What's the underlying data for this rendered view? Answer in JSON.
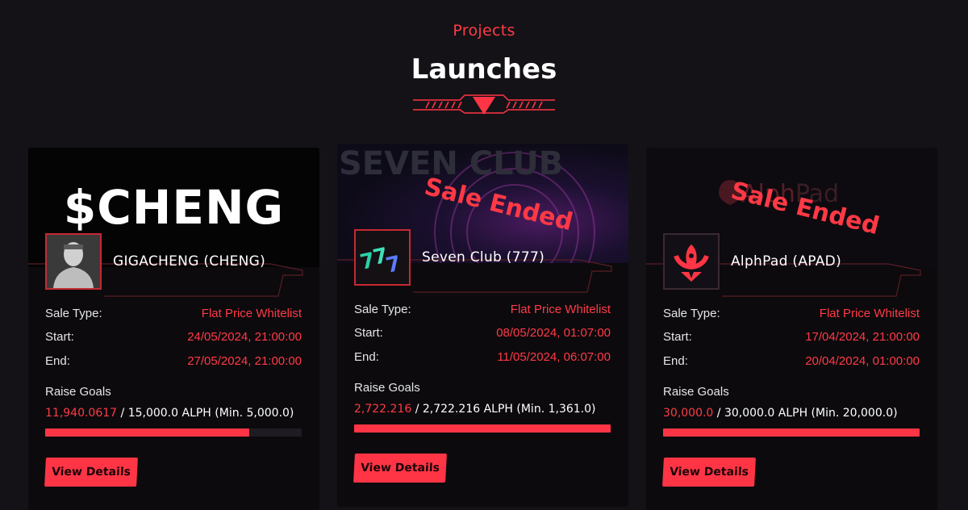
{
  "header": {
    "eyebrow": "Projects",
    "title": "Launches"
  },
  "colors": {
    "accent": "#ff3545",
    "background": "#141216",
    "card": "#0c0a0d"
  },
  "labels": {
    "sale_type": "Sale Type:",
    "start": "Start:",
    "end": "End:",
    "raise_goals": "Raise Goals",
    "view_details": "View Details"
  },
  "projects": [
    {
      "banner_text": "$CHENG",
      "name": "GIGACHENG (CHENG)",
      "sale_type": "Flat Price Whitelist",
      "start": "24/05/2024, 21:00:00",
      "end": "27/05/2024, 21:00:00",
      "raised": "11,940.0617",
      "goal": "/ 15,000.0 ALPH (Min. 5,000.0)",
      "progress": 0.796,
      "status": ""
    },
    {
      "banner_text": "SEVEN CLUB",
      "name": "Seven Club (777)",
      "sale_type": "Flat Price Whitelist",
      "start": "08/05/2024, 01:07:00",
      "end": "11/05/2024, 06:07:00",
      "raised": "2,722.216",
      "goal": "/ 2,722.216 ALPH (Min. 1,361.0)",
      "progress": 1.0,
      "status": "Sale Ended"
    },
    {
      "banner_text": "AlphPad",
      "name": "AlphPad (APAD)",
      "sale_type": "Flat Price Whitelist",
      "start": "17/04/2024, 21:00:00",
      "end": "20/04/2024, 01:00:00",
      "raised": "30,000.0",
      "goal": "/ 30,000.0 ALPH (Min. 20,000.0)",
      "progress": 1.0,
      "status": "Sale Ended"
    }
  ]
}
